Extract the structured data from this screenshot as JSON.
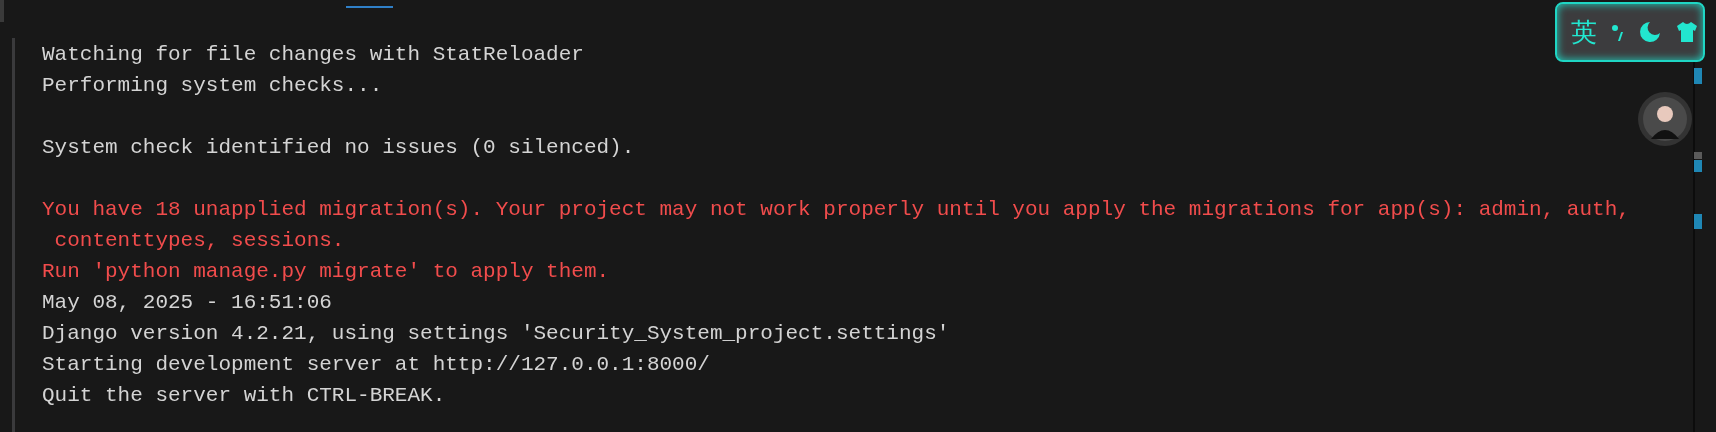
{
  "ime": {
    "mode_label": "英"
  },
  "terminal": {
    "lines": [
      {
        "kind": "normal",
        "text": "Watching for file changes with StatReloader"
      },
      {
        "kind": "normal",
        "text": "Performing system checks..."
      },
      {
        "kind": "blank"
      },
      {
        "kind": "normal",
        "text": "System check identified no issues (0 silenced)."
      },
      {
        "kind": "blank"
      },
      {
        "kind": "error",
        "text": "You have 18 unapplied migration(s). Your project may not work properly until you apply the migrations for app(s): admin, auth,"
      },
      {
        "kind": "error",
        "text": " contenttypes, sessions."
      },
      {
        "kind": "error",
        "text": "Run 'python manage.py migrate' to apply them."
      },
      {
        "kind": "normal",
        "text": "May 08, 2025 - 16:51:06"
      },
      {
        "kind": "normal",
        "text": "Django version 4.2.21, using settings 'Security_System_project.settings'"
      },
      {
        "kind": "normal",
        "text": "Starting development server at http://127.0.0.1:8000/"
      },
      {
        "kind": "normal",
        "text": "Quit the server with CTRL-BREAK."
      }
    ]
  }
}
